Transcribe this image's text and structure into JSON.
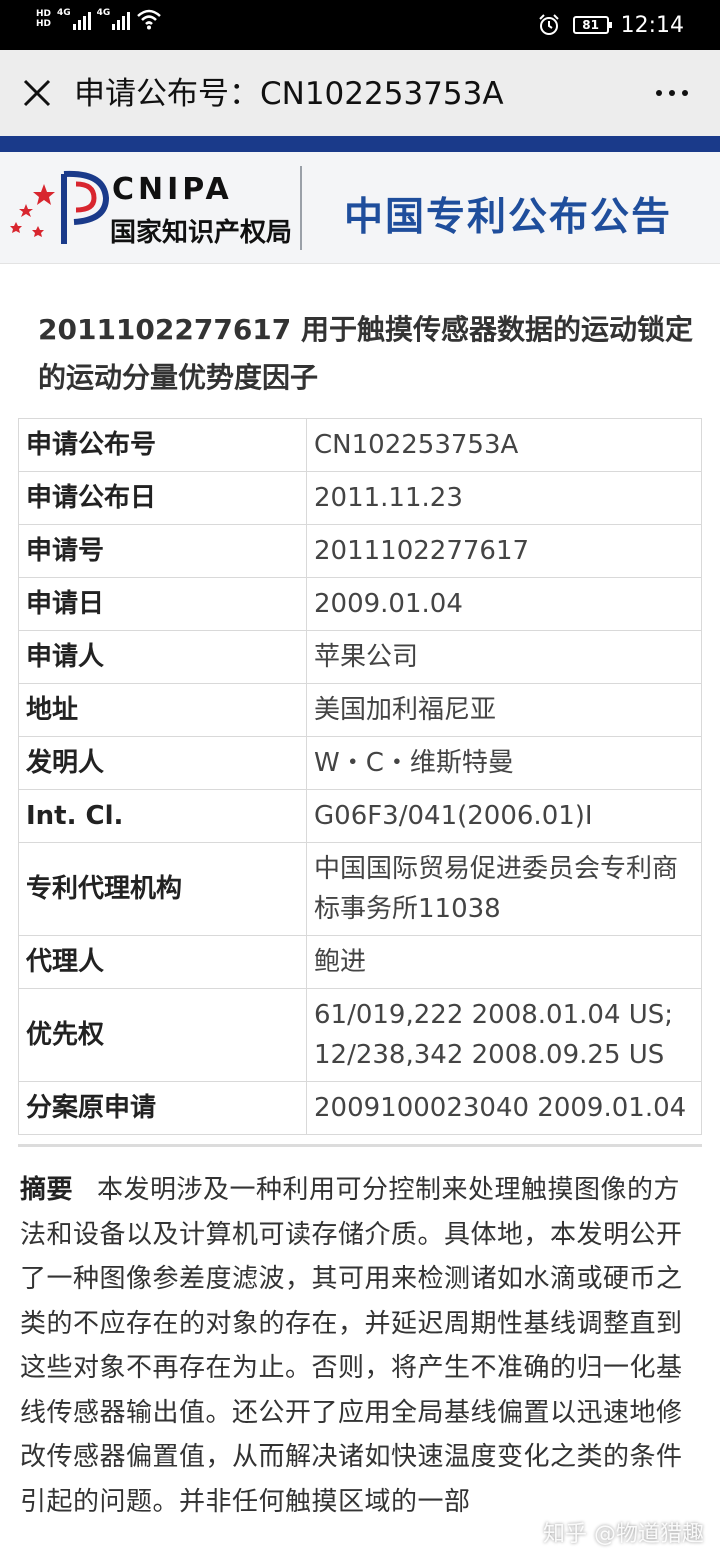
{
  "status_bar": {
    "hd1": "HD",
    "hd2": "HD",
    "sim1_label": "4G",
    "sim2_label": "4G",
    "battery": "81",
    "time": "12:14"
  },
  "header": {
    "title": "申请公布号：CN102253753A"
  },
  "banner": {
    "logo_text": "CNIPA",
    "org_name": "国家知识产权局",
    "publication_title": "中国专利公布公告"
  },
  "patent": {
    "heading": "2011102277617 用于触摸传感器数据的运动锁定的运动分量优势度因子",
    "rows": [
      {
        "key": "申请公布号",
        "value": "CN102253753A"
      },
      {
        "key": "申请公布日",
        "value": "2011.11.23"
      },
      {
        "key": "申请号",
        "value": "2011102277617"
      },
      {
        "key": "申请日",
        "value": "2009.01.04"
      },
      {
        "key": "申请人",
        "value": "苹果公司"
      },
      {
        "key": "地址",
        "value": "美国加利福尼亚"
      },
      {
        "key": "发明人",
        "value": "W・C・维斯特曼"
      },
      {
        "key": "Int. Cl.",
        "value": "G06F3/041(2006.01)I"
      },
      {
        "key": "专利代理机构",
        "value": "中国国际贸易促进委员会专利商标事务所11038"
      },
      {
        "key": "代理人",
        "value": "鲍进"
      },
      {
        "key": "优先权",
        "value": "61/019,222 2008.01.04 US; 12/238,342 2008.09.25 US"
      },
      {
        "key": "分案原申请",
        "value": "2009100023040 2009.01.04"
      }
    ],
    "abstract_label": "摘要",
    "abstract_text": "本发明涉及一种利用可分控制来处理触摸图像的方法和设备以及计算机可读存储介质。具体地，本发明公开了一种图像参差度滤波，其可用来检测诸如水滴或硬币之类的不应存在的对象的存在，并延迟周期性基线调整直到这些对象不再存在为止。否则，将产生不准确的归一化基线传感器输出值。还公开了应用全局基线偏置以迅速地修改传感器偏置值，从而解决诸如快速温度变化之类的条件引起的问题。并非任何触摸区域的一部"
  },
  "watermark": "知乎 @物道猎趣",
  "colors": {
    "status_bar": "#000000",
    "titlebar": "#ededed",
    "blue_band": "#1a3a8a",
    "publication_title": "#1f4e9c",
    "logo_red": "#d8262f"
  }
}
